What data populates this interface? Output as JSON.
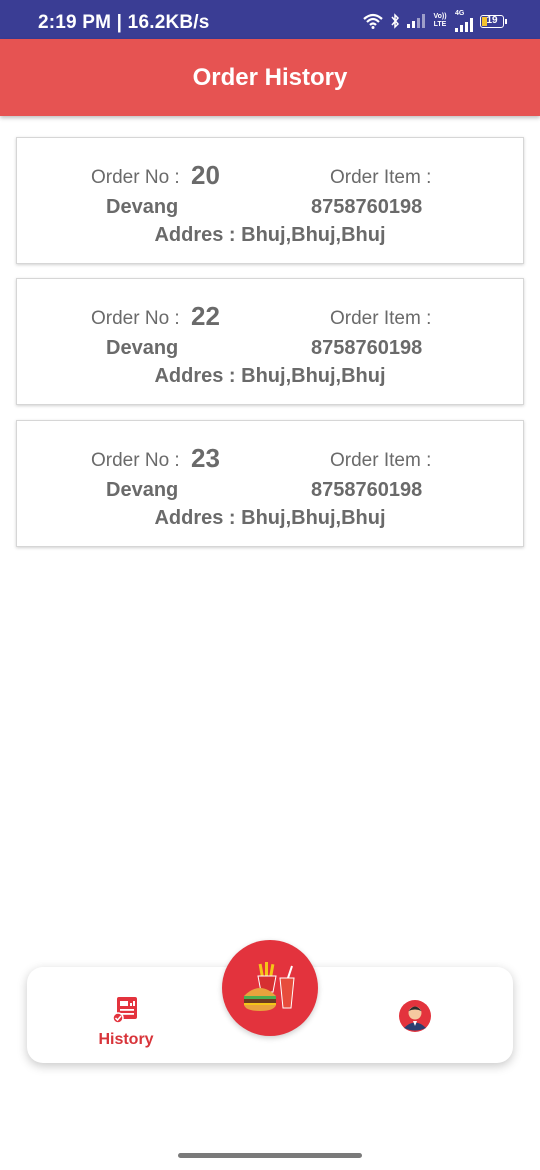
{
  "status_bar": {
    "time": "2:19 PM | 16.2KB/s",
    "network_label_top": "Vo)) LTE",
    "network_label_4g": "4G",
    "battery_level": "19"
  },
  "header": {
    "title": "Order History"
  },
  "orders": [
    {
      "order_no_label": "Order No :",
      "order_no": "20",
      "order_item_label": "Order Item :",
      "name": "Devang",
      "phone": "8758760198",
      "address": "Addres : Bhuj,Bhuj,Bhuj"
    },
    {
      "order_no_label": "Order No :",
      "order_no": "22",
      "order_item_label": "Order Item :",
      "name": "Devang",
      "phone": "8758760198",
      "address": "Addres : Bhuj,Bhuj,Bhuj"
    },
    {
      "order_no_label": "Order No :",
      "order_no": "23",
      "order_item_label": "Order Item :",
      "name": "Devang",
      "phone": "8758760198",
      "address": "Addres : Bhuj,Bhuj,Bhuj"
    }
  ],
  "bottom_nav": {
    "history_label": "History",
    "history_icon": "report-document-icon",
    "center_icon": "fast-food-icon",
    "profile_icon": "user-avatar-icon"
  },
  "colors": {
    "header_bg": "#e65352",
    "status_bg": "#3a3d94",
    "accent": "#e3333d",
    "text": "#6a6a6a"
  }
}
